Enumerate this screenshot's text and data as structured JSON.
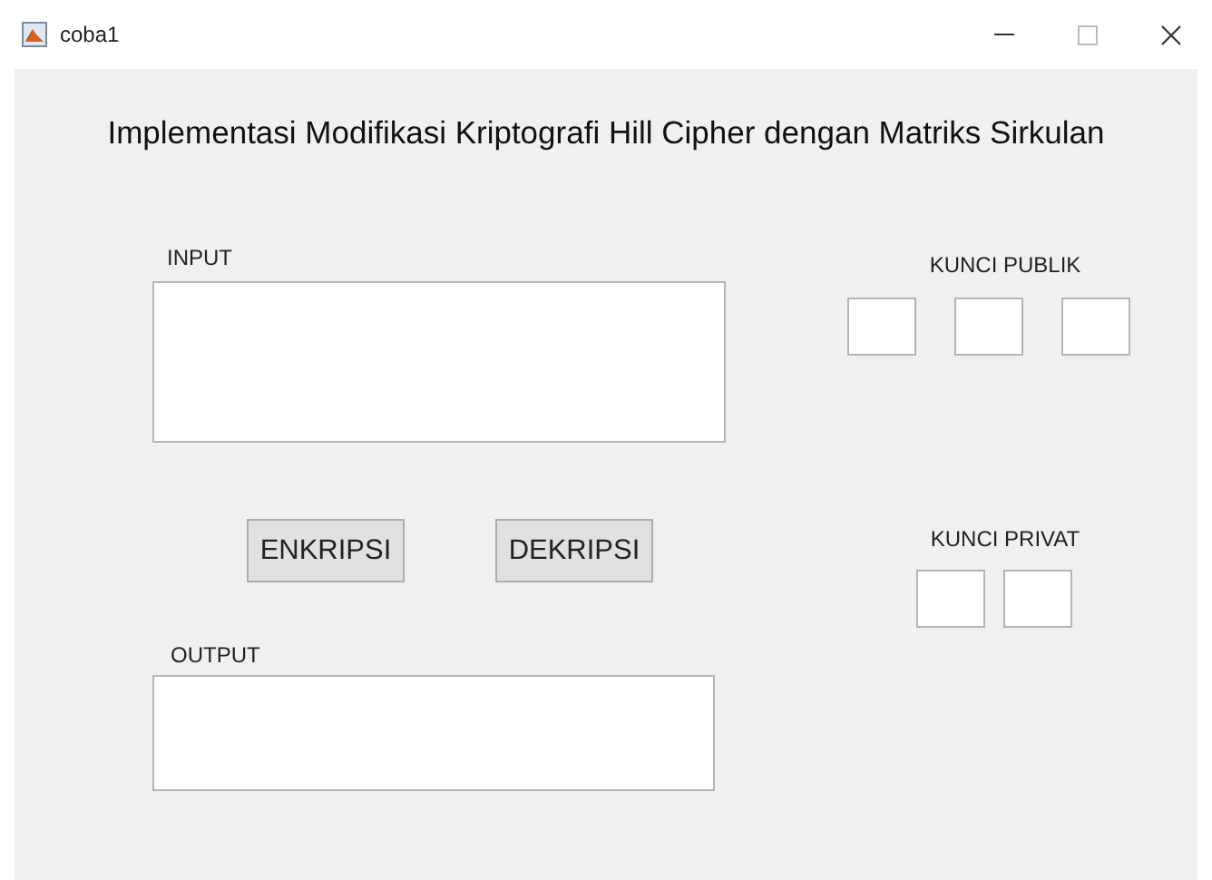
{
  "window": {
    "title": "coba1"
  },
  "heading": "Implementasi Modifikasi Kriptografi Hill Cipher dengan Matriks Sirkulan",
  "input": {
    "label": "INPUT"
  },
  "buttons": [
    "ENKRIPSI",
    "DEKRIPSI"
  ],
  "output": {
    "label": "OUTPUT"
  },
  "public_key": {
    "label": "KUNCI PUBLIK",
    "fields": [
      {
        "kind": "text"
      },
      {
        "kind": "text"
      },
      {
        "kind": "text"
      }
    ]
  },
  "private_key": {
    "label": "KUNCI PRIVAT",
    "fields": [
      {
        "kind": "text"
      },
      {
        "kind": "text"
      }
    ]
  }
}
